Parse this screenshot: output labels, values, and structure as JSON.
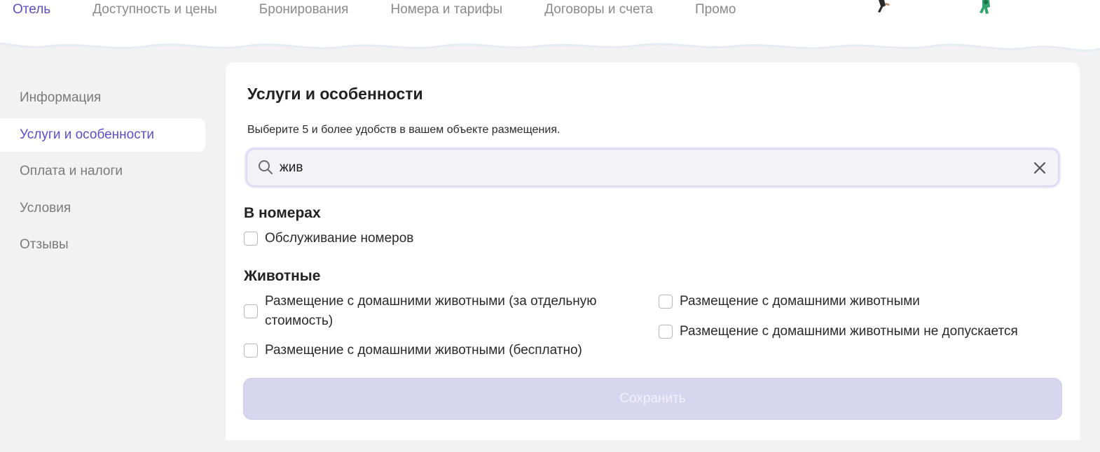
{
  "nav": {
    "items": [
      {
        "label": "Отель",
        "active": true
      },
      {
        "label": "Доступность и цены",
        "active": false
      },
      {
        "label": "Бронирования",
        "active": false
      },
      {
        "label": "Номера и тарифы",
        "active": false
      },
      {
        "label": "Договоры и счета",
        "active": false
      },
      {
        "label": "Промо",
        "active": false
      }
    ]
  },
  "sidebar": {
    "items": [
      {
        "label": "Информация",
        "active": false
      },
      {
        "label": "Услуги и особенности",
        "active": true
      },
      {
        "label": "Оплата и налоги",
        "active": false
      },
      {
        "label": "Условия",
        "active": false
      },
      {
        "label": "Отзывы",
        "active": false
      }
    ]
  },
  "panel": {
    "title": "Услуги и особенности",
    "hint": "Выберите 5 и более удобств в вашем объекте размещения.",
    "search": {
      "value": "жив",
      "icon": "search-icon",
      "clear_icon": "close-icon"
    },
    "sections": [
      {
        "title": "В номерах",
        "options": [
          {
            "label": "Обслуживание номеров",
            "checked": false
          }
        ]
      },
      {
        "title": "Животные",
        "options": [
          {
            "label": "Размещение с домашними животными (за отдельную стоимость)",
            "checked": false
          },
          {
            "label": "Размещение с домашними животными (бесплатно)",
            "checked": false
          },
          {
            "label": "Размещение с домашними животными",
            "checked": false
          },
          {
            "label": "Размещение с домашними животными не допускается",
            "checked": false
          }
        ]
      }
    ],
    "save_label": "Сохранить"
  },
  "colors": {
    "accent": "#5b4fc7",
    "page_bg": "#f2f2f2",
    "save_disabled_bg": "#d8d5ee"
  }
}
